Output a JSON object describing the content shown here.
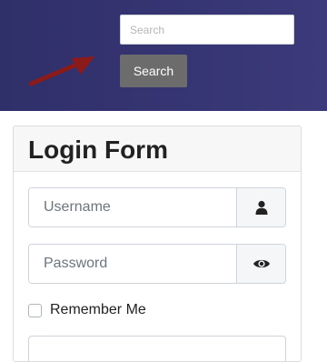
{
  "header": {
    "search": {
      "placeholder": "Search",
      "value": ""
    },
    "search_button_label": "Search",
    "arrow_color": "#8b1a1a"
  },
  "login": {
    "title": "Login Form",
    "username": {
      "placeholder": "Username",
      "icon": "user-icon"
    },
    "password": {
      "placeholder": "Password",
      "icon": "eye-icon"
    },
    "remember_label": "Remember Me"
  },
  "colors": {
    "header_bg": "#35336f",
    "button_bg": "#6c6c6c",
    "card_header_bg": "#f7f7f7",
    "addon_bg": "#f4f6f8"
  }
}
